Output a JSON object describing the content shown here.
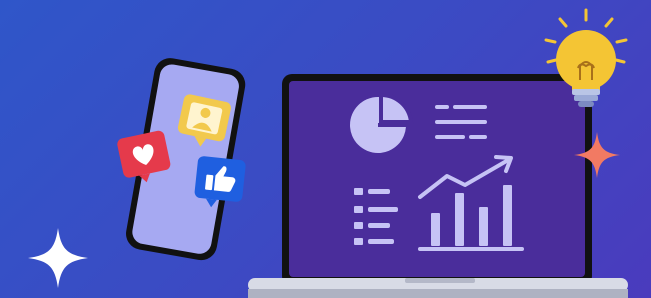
{
  "scene": {
    "description_free": true,
    "icons": [
      "phone-icon",
      "user-reaction-icon",
      "heart-reaction-icon",
      "thumbs-up-reaction-icon",
      "laptop-icon",
      "pie-chart-icon",
      "bar-chart-icon",
      "trend-arrow-icon",
      "lightbulb-icon",
      "sparkle-icon"
    ],
    "colors": {
      "background_start": "#2f56c9",
      "background_end": "#4a3bbd",
      "phone_screen": "#a6a9f2",
      "laptop_screen": "#4a2d9b",
      "chart_stroke": "#c6c3f5",
      "heart_badge": "#e53a4b",
      "user_badge": "#f2c94c",
      "like_badge": "#1f5fe0",
      "bulb": "#f4c534",
      "sparkle_orange": "#f27a63",
      "sparkle_white": "#ffffff"
    }
  }
}
